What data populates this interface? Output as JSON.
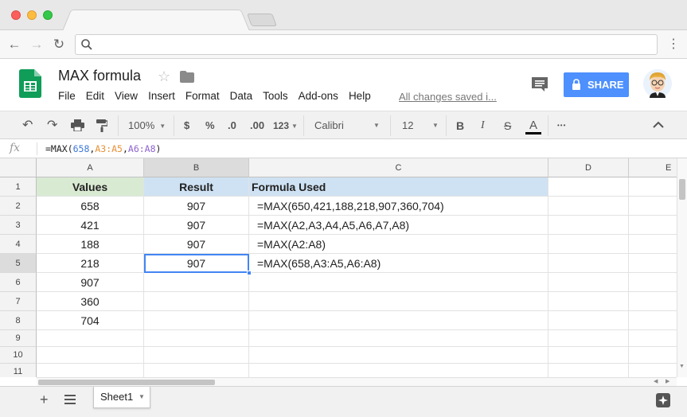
{
  "app": {
    "doc_title": "MAX formula",
    "menu": [
      "File",
      "Edit",
      "View",
      "Insert",
      "Format",
      "Data",
      "Tools",
      "Add-ons",
      "Help"
    ],
    "save_status": "All changes saved i...",
    "share_label": "SHARE"
  },
  "toolbar": {
    "zoom": "100%",
    "currency": "$",
    "percent": "%",
    "decrease_decimals": ".0",
    "increase_decimals": ".00",
    "more_formats": "123",
    "font": "Calibri",
    "font_size": "12",
    "bold": "B",
    "italic": "I",
    "strikethrough": "S",
    "text_color": "A",
    "more": "•••"
  },
  "formula_bar": {
    "fx_label": "fx",
    "prefix": "=MAX(",
    "arg1": "658",
    "comma1": ",",
    "arg2": "A3:A5",
    "comma2": ",",
    "arg3": "A6:A8",
    "suffix": ")"
  },
  "grid": {
    "columns": [
      "A",
      "B",
      "C",
      "D",
      "E"
    ],
    "rows": [
      "1",
      "2",
      "3",
      "4",
      "5",
      "6",
      "7",
      "8",
      "9",
      "10",
      "11"
    ],
    "header": {
      "values": "Values",
      "result": "Result",
      "formula": "Formula Used"
    },
    "values": [
      "658",
      "421",
      "188",
      "218",
      "907",
      "360",
      "704"
    ],
    "results": [
      "907",
      "907",
      "907",
      "907"
    ],
    "formulas": [
      "=MAX(650,421,188,218,907,360,704)",
      "=MAX(A2,A3,A4,A5,A6,A7,A8)",
      "=MAX(A2:A8)",
      "=MAX(658,A3:A5,A6:A8)"
    ],
    "selected_cell": "B5"
  },
  "sheets": {
    "tabs": [
      "Sheet1"
    ],
    "add_label": "+"
  },
  "colors": {
    "values_header_bg": "#d9ead3",
    "result_header_bg": "#cfe2f3",
    "share_bg": "#4d90fe",
    "selection": "#4285f4",
    "sheets_green": "#0f9d58"
  }
}
